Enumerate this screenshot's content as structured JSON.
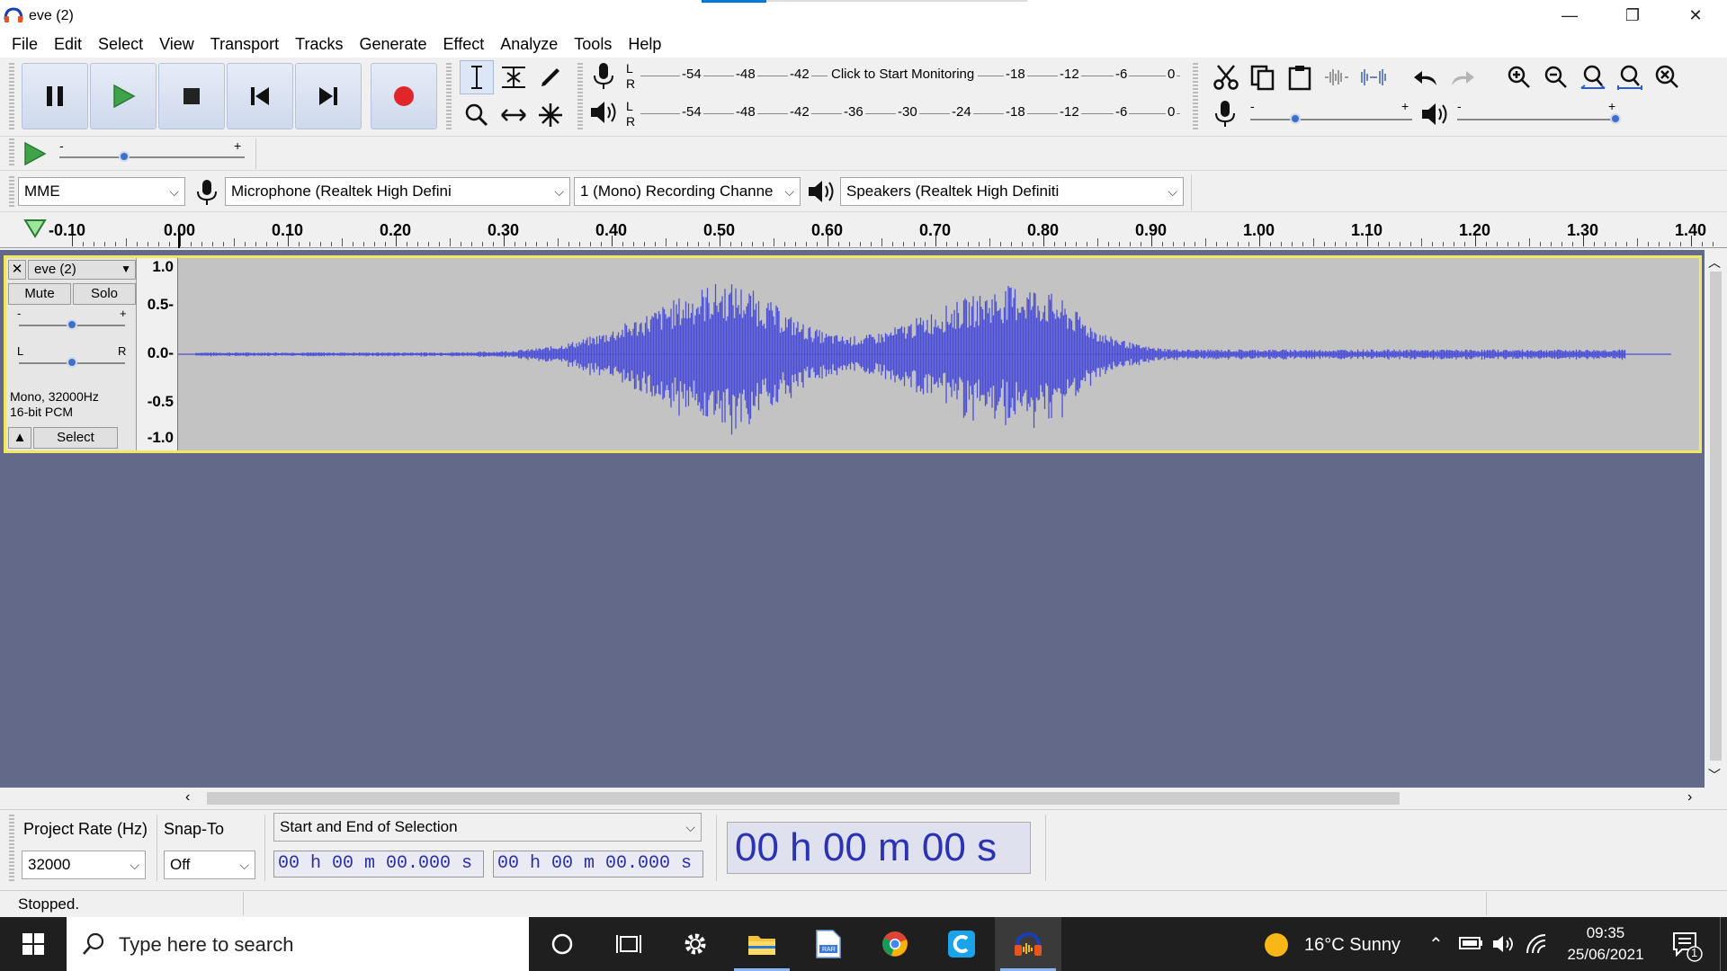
{
  "window": {
    "title": "eve (2)",
    "minimize": "—",
    "restore": "❐",
    "close": "✕"
  },
  "menu": [
    "File",
    "Edit",
    "Select",
    "View",
    "Transport",
    "Tracks",
    "Generate",
    "Effect",
    "Analyze",
    "Tools",
    "Help"
  ],
  "meters": {
    "record_prompt": "Click to Start Monitoring",
    "record_ticks_left": [
      "-54",
      "-48",
      "-42"
    ],
    "record_ticks_right": [
      "-18",
      "-12",
      "-6",
      "0"
    ],
    "play_ticks": [
      "-54",
      "-48",
      "-42",
      "-36",
      "-30",
      "-24",
      "-18",
      "-12",
      "-6",
      "0"
    ],
    "L": "L",
    "R": "R"
  },
  "sliders": {
    "minus": "-",
    "plus": "+",
    "play_speed_level": 0.35,
    "rec_volume_level": 0.28,
    "play_volume_level": 0.98
  },
  "devices": {
    "host": "MME",
    "mic": "Microphone (Realtek High Defini",
    "channels": "1 (Mono) Recording Channe",
    "speakers": "Speakers (Realtek High Definiti"
  },
  "ruler": {
    "labels": [
      "-0.10",
      "0.00",
      "0.10",
      "0.20",
      "0.30",
      "0.40",
      "0.50",
      "0.60",
      "0.70",
      "0.80",
      "0.90",
      "1.00",
      "1.10",
      "1.20",
      "1.30",
      "1.40"
    ]
  },
  "track": {
    "name": "eve (2)",
    "close": "✕",
    "mute": "Mute",
    "solo": "Solo",
    "gain_minus": "-",
    "gain_plus": "+",
    "pan_left": "L",
    "pan_right": "R",
    "info_line1": "Mono, 32000Hz",
    "info_line2": "16-bit PCM",
    "select": "Select",
    "vruler": [
      "1.0",
      "0.5-",
      "0.0-",
      "-0.5",
      "-1.0"
    ]
  },
  "selection": {
    "rate_label": "Project Rate (Hz)",
    "rate_value": "32000",
    "snap_label": "Snap-To",
    "snap_value": "Off",
    "mode": "Start and End of Selection",
    "start_time": "00 h 00 m 00.000 s",
    "end_time": "00 h 00 m 00.000 s",
    "big_time": "00 h 00 m 00 s"
  },
  "status": {
    "text": "Stopped."
  },
  "taskbar": {
    "search_placeholder": "Type here to search",
    "weather": "16°C  Sunny",
    "time": "09:35",
    "date": "25/06/2021",
    "notifications": "1"
  },
  "colors": {
    "waveform": "#4b4fd6",
    "track_bg": "#c3c3c3",
    "area_bg": "#636988",
    "selection_border": "#f0e860"
  }
}
